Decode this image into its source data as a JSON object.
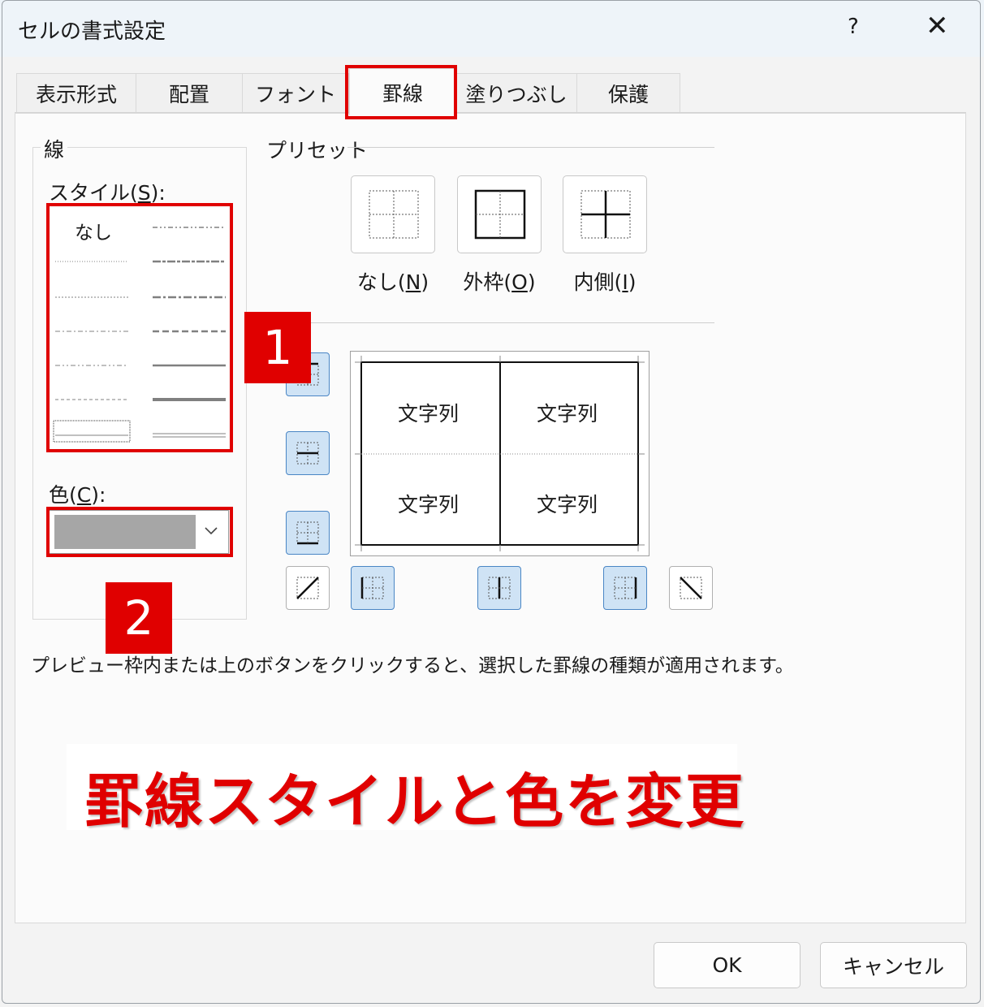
{
  "window": {
    "title": "セルの書式設定",
    "help": "?",
    "close": "✕"
  },
  "tabs": [
    {
      "label": "表示形式"
    },
    {
      "label": "配置"
    },
    {
      "label": "フォント"
    },
    {
      "label": "罫線",
      "active": true
    },
    {
      "label": "塗りつぶし"
    },
    {
      "label": "保護"
    }
  ],
  "line_group": {
    "legend": "線",
    "style_label": "スタイル(",
    "style_key": "S",
    "style_label_end": "):",
    "style_none": "なし",
    "color_label": "色(",
    "color_key": "C",
    "color_label_end": "):",
    "color_value": "#a6a6a6"
  },
  "presets": {
    "legend": "プリセット",
    "none": {
      "label": "なし(",
      "key": "N",
      "end": ")"
    },
    "outline": {
      "label": "外枠(",
      "key": "O",
      "end": ")"
    },
    "inside": {
      "label": "内側(",
      "key": "I",
      "end": ")"
    }
  },
  "preview_cells": [
    "文字列",
    "文字列",
    "文字列",
    "文字列"
  ],
  "hint": "プレビュー枠内または上のボタンをクリックすると、選択した罫線の種類が適用されます。",
  "annotations": {
    "badge1": "1",
    "badge2": "2",
    "banner": "罫線スタイルと色を変更"
  },
  "buttons": {
    "ok": "OK",
    "cancel": "キャンセル"
  }
}
